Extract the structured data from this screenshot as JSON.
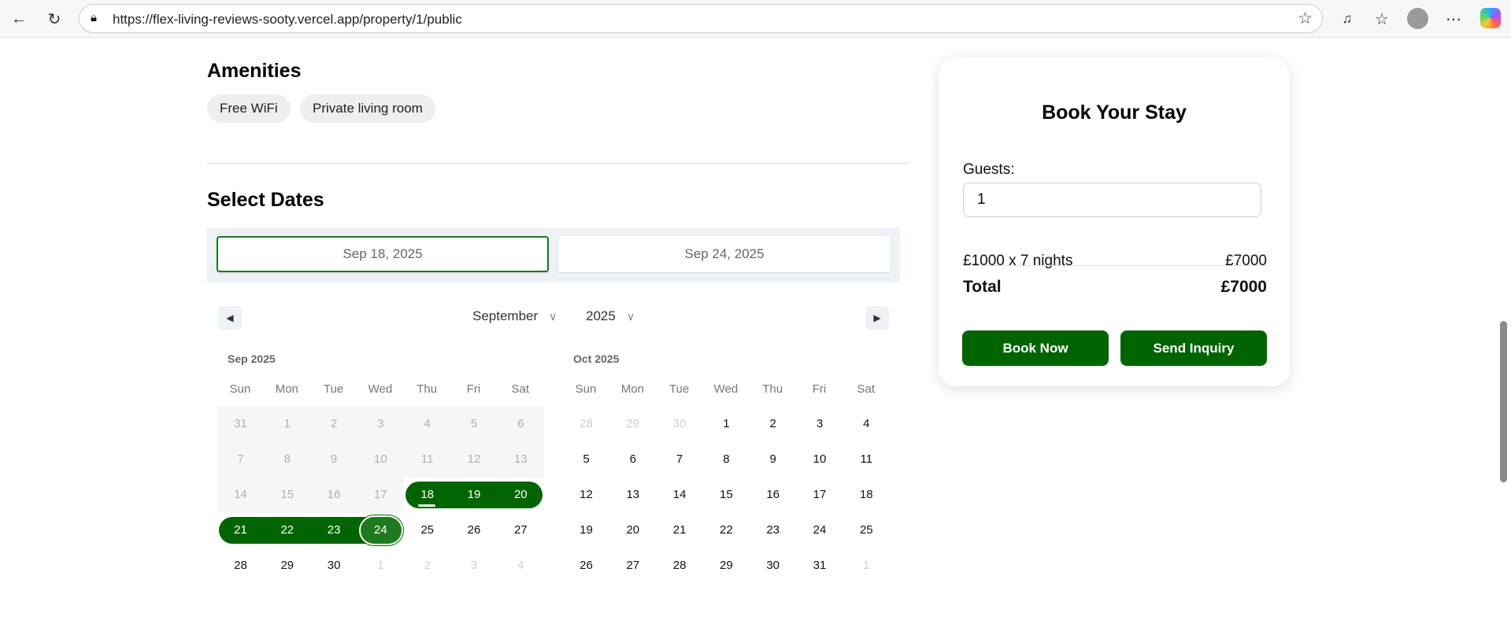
{
  "browser": {
    "url": "https://flex-living-reviews-sooty.vercel.app/property/1/public"
  },
  "amenities": {
    "title": "Amenities",
    "items": [
      "Free WiFi",
      "Private living room"
    ]
  },
  "dates": {
    "title": "Select Dates",
    "start": "Sep 18, 2025",
    "end": "Sep 24, 2025",
    "month_select": "September",
    "year_select": "2025",
    "weekdays": [
      "Sun",
      "Mon",
      "Tue",
      "Wed",
      "Thu",
      "Fri",
      "Sat"
    ],
    "months": [
      {
        "title": "Sep 2025",
        "weeks": [
          [
            "31",
            "1",
            "2",
            "3",
            "4",
            "5",
            "6"
          ],
          [
            "7",
            "8",
            "9",
            "10",
            "11",
            "12",
            "13"
          ],
          [
            "14",
            "15",
            "16",
            "17",
            "18",
            "19",
            "20"
          ],
          [
            "21",
            "22",
            "23",
            "24",
            "25",
            "26",
            "27"
          ],
          [
            "28",
            "29",
            "30",
            "1",
            "2",
            "3",
            "4"
          ]
        ],
        "disabled_before_index": 18,
        "outside_from_index": 31,
        "outside_before_index": 0,
        "range": [
          18,
          24
        ]
      },
      {
        "title": "Oct 2025",
        "weeks": [
          [
            "28",
            "29",
            "30",
            "1",
            "2",
            "3",
            "4"
          ],
          [
            "5",
            "6",
            "7",
            "8",
            "9",
            "10",
            "11"
          ],
          [
            "12",
            "13",
            "14",
            "15",
            "16",
            "17",
            "18"
          ],
          [
            "19",
            "20",
            "21",
            "22",
            "23",
            "24",
            "25"
          ],
          [
            "26",
            "27",
            "28",
            "29",
            "30",
            "31",
            "1"
          ]
        ],
        "outside_before_index": 3,
        "outside_from_index": 34
      }
    ]
  },
  "booking": {
    "title": "Book Your Stay",
    "guests_label": "Guests:",
    "guests_value": "1",
    "line_label": "£1000 x 7 nights",
    "line_value": "£7000",
    "total_label": "Total",
    "total_value": "£7000",
    "book_now": "Book Now",
    "send_inquiry": "Send Inquiry"
  },
  "colors": {
    "accent": "#006400"
  }
}
